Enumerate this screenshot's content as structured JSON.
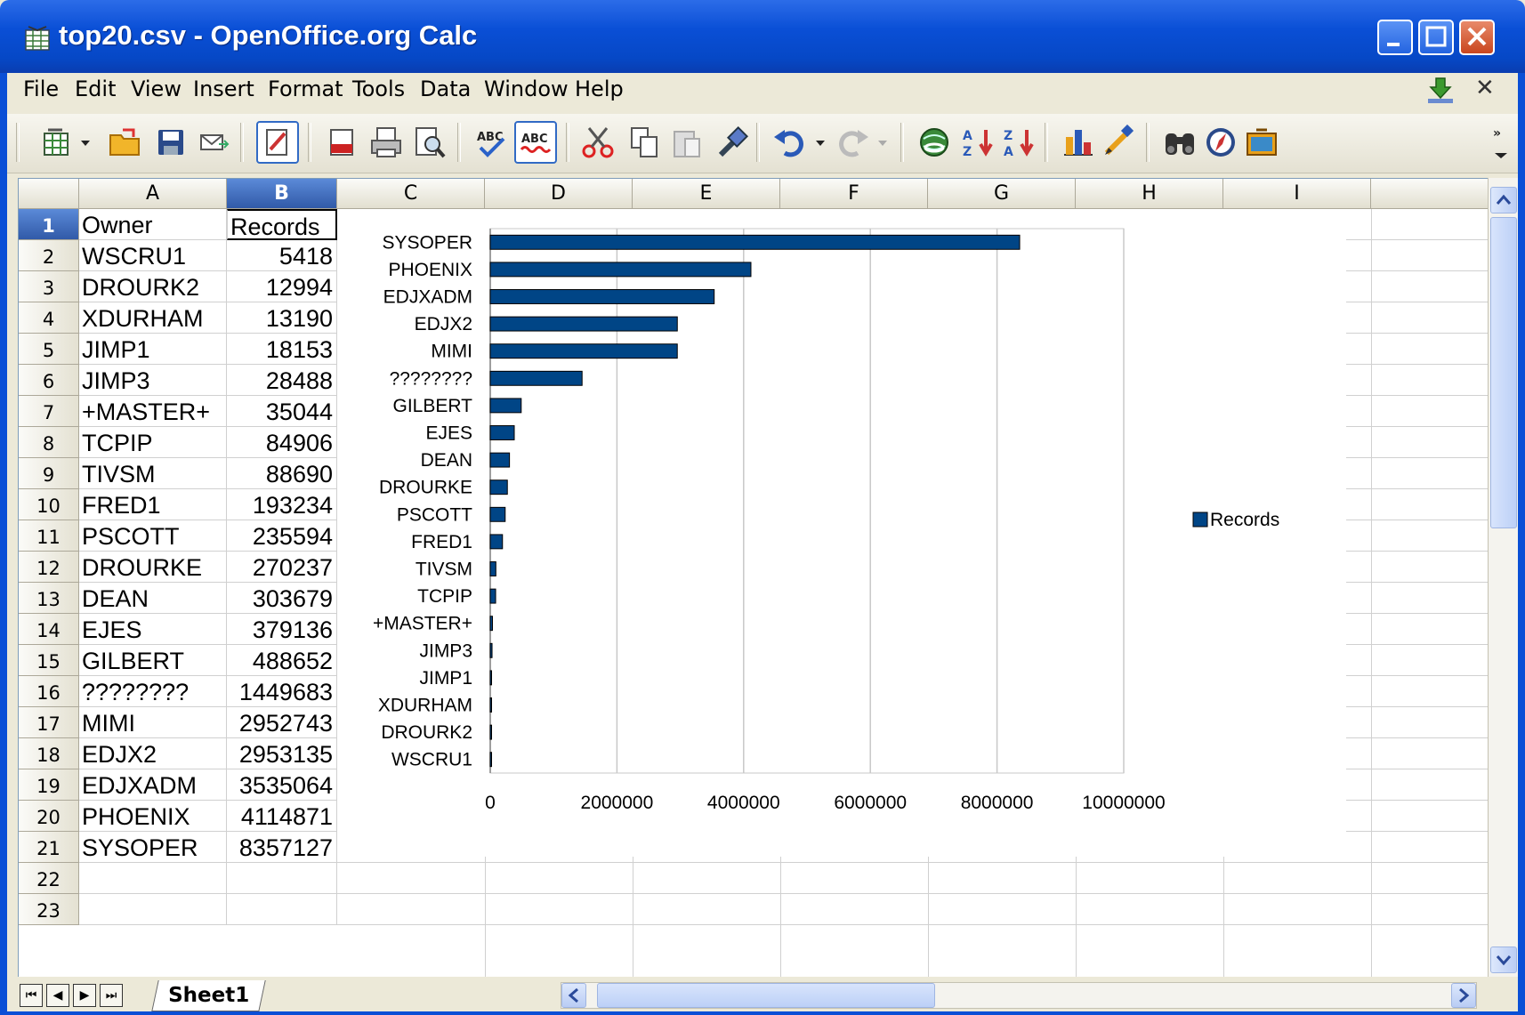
{
  "window": {
    "title": "top20.csv - OpenOffice.org Calc"
  },
  "menu": [
    "File",
    "Edit",
    "View",
    "Insert",
    "Format",
    "Tools",
    "Data",
    "Window",
    "Help"
  ],
  "toolbar": {
    "icons": [
      "new-icon",
      "open-icon",
      "save-icon",
      "email-icon",
      "edit-mode-icon",
      "export-pdf-icon",
      "print-icon",
      "page-preview-icon",
      "spellcheck-icon",
      "autospell-icon",
      "cut-icon",
      "copy-icon",
      "paste-icon",
      "format-paintbrush-icon",
      "undo-icon",
      "redo-icon",
      "hyperlink-icon",
      "sort-ascending-icon",
      "sort-descending-icon",
      "insert-chart-icon",
      "draw-functions-icon",
      "find-replace-icon",
      "navigator-icon",
      "gallery-icon"
    ]
  },
  "columns": [
    "A",
    "B",
    "C",
    "D",
    "E",
    "F",
    "G",
    "H",
    "I"
  ],
  "rows": [
    {
      "n": "1",
      "a": "Owner",
      "b": "Records"
    },
    {
      "n": "2",
      "a": "WSCRU1",
      "b": "5418"
    },
    {
      "n": "3",
      "a": "DROURK2",
      "b": "12994"
    },
    {
      "n": "4",
      "a": "XDURHAM",
      "b": "13190"
    },
    {
      "n": "5",
      "a": "JIMP1",
      "b": "18153"
    },
    {
      "n": "6",
      "a": "JIMP3",
      "b": "28488"
    },
    {
      "n": "7",
      "a": "+MASTER+",
      "b": "35044"
    },
    {
      "n": "8",
      "a": "TCPIP",
      "b": "84906"
    },
    {
      "n": "9",
      "a": "TIVSM",
      "b": "88690"
    },
    {
      "n": "10",
      "a": "FRED1",
      "b": "193234"
    },
    {
      "n": "11",
      "a": "PSCOTT",
      "b": "235594"
    },
    {
      "n": "12",
      "a": "DROURKE",
      "b": "270237"
    },
    {
      "n": "13",
      "a": "DEAN",
      "b": "303679"
    },
    {
      "n": "14",
      "a": "EJES",
      "b": "379136"
    },
    {
      "n": "15",
      "a": "GILBERT",
      "b": "488652"
    },
    {
      "n": "16",
      "a": "????????",
      "b": "1449683"
    },
    {
      "n": "17",
      "a": "MIMI",
      "b": "2952743"
    },
    {
      "n": "18",
      "a": "EDJX2",
      "b": "2953135"
    },
    {
      "n": "19",
      "a": "EDJXADM",
      "b": "3535064"
    },
    {
      "n": "20",
      "a": "PHOENIX",
      "b": "4114871"
    },
    {
      "n": "21",
      "a": "SYSOPER",
      "b": "8357127"
    },
    {
      "n": "22",
      "a": "",
      "b": ""
    },
    {
      "n": "23",
      "a": "",
      "b": ""
    }
  ],
  "chart_data": {
    "type": "bar",
    "orientation": "horizontal",
    "categories": [
      "SYSOPER",
      "PHOENIX",
      "EDJXADM",
      "EDJX2",
      "MIMI",
      "????????",
      "GILBERT",
      "EJES",
      "DEAN",
      "DROURKE",
      "PSCOTT",
      "FRED1",
      "TIVSM",
      "TCPIP",
      "+MASTER+",
      "JIMP3",
      "JIMP1",
      "XDURHAM",
      "DROURK2",
      "WSCRU1"
    ],
    "series": [
      {
        "name": "Records",
        "values": [
          8357127,
          4114871,
          3535064,
          2953135,
          2952743,
          1449683,
          488652,
          379136,
          303679,
          270237,
          235594,
          193234,
          88690,
          84906,
          35044,
          28488,
          18153,
          13190,
          12994,
          5418
        ]
      }
    ],
    "xlim": [
      0,
      10000000
    ],
    "ticks": [
      "0",
      "2000000",
      "4000000",
      "6000000",
      "8000000",
      "10000000"
    ],
    "grid": true,
    "legend": "right",
    "bar_color": "#004586"
  },
  "sheet_tabs": [
    "Sheet1"
  ]
}
